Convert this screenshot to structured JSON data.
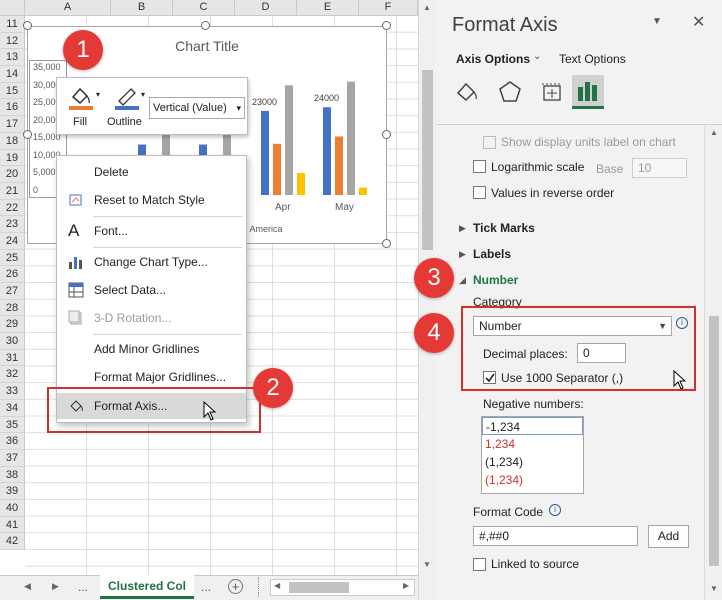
{
  "sheet": {
    "columns": [
      "A",
      "B",
      "C",
      "D",
      "E",
      "F"
    ],
    "rows": [
      "11",
      "12",
      "13",
      "14",
      "15",
      "16",
      "17",
      "18",
      "19",
      "20",
      "21",
      "22",
      "23",
      "24",
      "25",
      "26",
      "27",
      "28",
      "29",
      "30",
      "31",
      "32",
      "33",
      "34",
      "35",
      "36",
      "37",
      "38",
      "39",
      "40",
      "41",
      "42"
    ]
  },
  "chart": {
    "title": "Chart Title",
    "y_ticks": [
      "35,000",
      "30,000",
      "25,000",
      "20,000",
      "15,000",
      "10,000",
      "5,000",
      "0"
    ],
    "data_labels": [
      "23000",
      "24000"
    ],
    "x_categories": [
      "Apr",
      "May"
    ],
    "legend_partial": "th America",
    "colors": {
      "blue": "#4472c4",
      "orange": "#ed7d31",
      "gray": "#a5a5a5",
      "gold": "#ffc000"
    }
  },
  "chart_data": {
    "type": "bar",
    "categories": [
      "Apr",
      "May"
    ],
    "series": [
      {
        "values": [
          23000,
          24000
        ]
      },
      {
        "values": [
          14000,
          16000
        ]
      },
      {
        "values": [
          30000,
          31000
        ]
      },
      {
        "values": [
          6000,
          2000
        ]
      }
    ],
    "ylim": [
      0,
      35000
    ]
  },
  "mini_toolbar": {
    "fill_label": "Fill",
    "outline_label": "Outline",
    "axis_select_value": "Vertical (Value)"
  },
  "context_menu": {
    "items": [
      {
        "label": "Delete",
        "icon": ""
      },
      {
        "label": "Reset to Match Style",
        "icon": "reset-style-icon"
      },
      {
        "label": "Font...",
        "icon": "font-icon"
      },
      {
        "label": "Change Chart Type...",
        "icon": "chart-type-icon"
      },
      {
        "label": "Select Data...",
        "icon": "select-data-icon"
      },
      {
        "label": "3-D Rotation...",
        "icon": "rotation-icon"
      },
      {
        "label": "Add Minor Gridlines",
        "icon": ""
      },
      {
        "label": "Format Major Gridlines...",
        "icon": ""
      },
      {
        "label": "Format Axis...",
        "icon": "format-axis-icon"
      }
    ]
  },
  "badges": [
    "1",
    "2",
    "3",
    "4"
  ],
  "tabs": {
    "nav_prev": "◀",
    "nav_next": "▶",
    "ellipsis_left": "...",
    "active_sheet": "Clustered Col",
    "ellipsis_right": "...",
    "add": "+"
  },
  "pane": {
    "title": "Format Axis",
    "tab_axis_options": "Axis Options",
    "tab_text_options": "Text Options",
    "show_display_units": "Show display units label on chart",
    "logarithmic_scale": "Logarithmic scale",
    "base_label": "Base",
    "base_value": "10",
    "values_reverse": "Values in reverse order",
    "tick_marks": "Tick Marks",
    "labels": "Labels",
    "number": "Number",
    "category_label": "Category",
    "category_value": "Number",
    "decimal_places_label": "Decimal places:",
    "decimal_places_value": "0",
    "use_1000_separator": "Use 1000 Separator (,)",
    "negative_numbers_label": "Negative numbers:",
    "negative_numbers": [
      "-1,234",
      "1,234",
      "(1,234)",
      "(1,234)"
    ],
    "format_code_label": "Format Code",
    "format_code_value": "#,##0",
    "add_button": "Add",
    "linked_to_source": "Linked to source",
    "accent_color": "#217346"
  }
}
